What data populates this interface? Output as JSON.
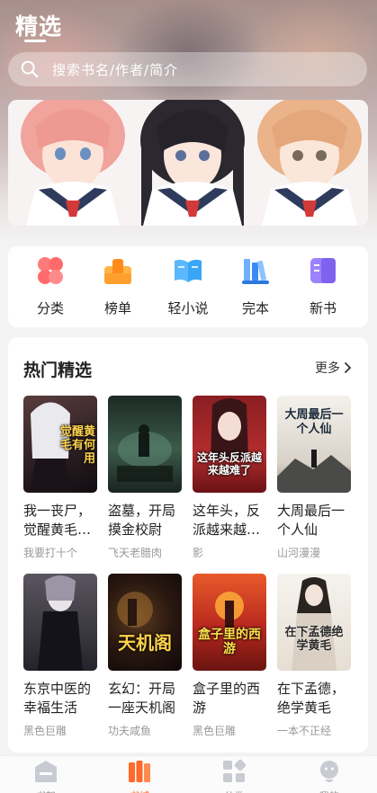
{
  "header": {
    "title": "精选",
    "search_placeholder": "搜索书名/作者/简介"
  },
  "categories": [
    {
      "label": "分类",
      "icon": "grid-icon",
      "color": "#ff6b6b"
    },
    {
      "label": "榜单",
      "icon": "trophy-icon",
      "color": "#ff9f2e"
    },
    {
      "label": "轻小说",
      "icon": "open-book-icon",
      "color": "#3aa6f5"
    },
    {
      "label": "完本",
      "icon": "books-icon",
      "color": "#3a8cf5"
    },
    {
      "label": "新书",
      "icon": "new-book-icon",
      "color": "#8a6cf5"
    }
  ],
  "hot": {
    "title": "热门精选",
    "more_label": "更多",
    "books": [
      {
        "title": "我一丧尸，觉醒黄毛有何用？",
        "author": "我要打十个",
        "cover_text": "觉醒黄毛有何用",
        "cover_color": "#3a2a2a"
      },
      {
        "title": "盗墓，开局摸金校尉",
        "author": "飞天老腊肉",
        "cover_text": "",
        "cover_color": "#2f4a3c"
      },
      {
        "title": "这年头，反派越来越难了",
        "author": "影",
        "cover_text": "这年头反派越来越难了",
        "cover_color": "#b02a2a"
      },
      {
        "title": "大周最后一个人仙",
        "author": "山河漫漫",
        "cover_text": "大周最后一个人仙",
        "cover_color": "#eae6e0"
      },
      {
        "title": "东京中医的幸福生活",
        "author": "黑色巨雕",
        "cover_text": "",
        "cover_color": "#4a4a52"
      },
      {
        "title": "玄幻：开局一座天机阁",
        "author": "功夫咸鱼",
        "cover_text": "天机阁",
        "cover_color": "#1a1010"
      },
      {
        "title": "盒子里的西游",
        "author": "黑色巨雕",
        "cover_text": "盒子里的西游",
        "cover_color": "#c0392b"
      },
      {
        "title": "在下孟德，绝学黄毛",
        "author": "一本不正经",
        "cover_text": "在下孟德绝学黄毛",
        "cover_color": "#efe9e2"
      }
    ]
  },
  "tabbar": {
    "active_color": "#ff6a2b",
    "items": [
      {
        "label": "书架",
        "icon": "bookshelf-icon"
      },
      {
        "label": "书城",
        "icon": "bookstore-icon"
      },
      {
        "label": "分类",
        "icon": "category-icon"
      },
      {
        "label": "我的",
        "icon": "profile-icon"
      }
    ]
  }
}
